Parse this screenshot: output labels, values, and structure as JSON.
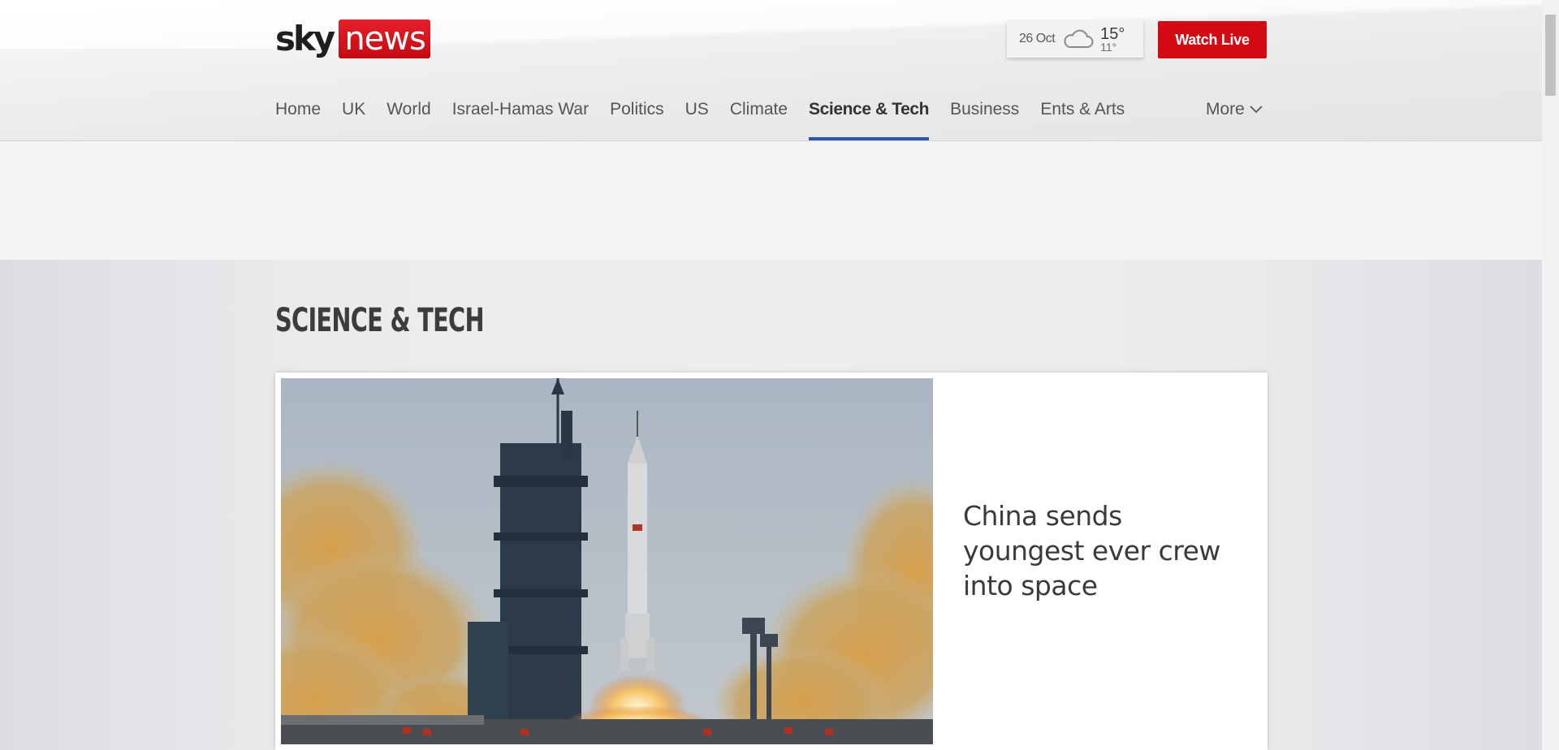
{
  "header": {
    "logo": {
      "sky": "sky",
      "news": "news"
    },
    "weather": {
      "date": "26 Oct",
      "icon": "cloud-icon",
      "high": "15°",
      "low": "11°"
    },
    "watch_live_label": "Watch Live",
    "nav": {
      "items": [
        {
          "label": "Home"
        },
        {
          "label": "UK"
        },
        {
          "label": "World"
        },
        {
          "label": "Israel-Hamas War"
        },
        {
          "label": "Politics"
        },
        {
          "label": "US"
        },
        {
          "label": "Climate"
        },
        {
          "label": "Science & Tech",
          "active": true
        },
        {
          "label": "Business"
        },
        {
          "label": "Ents & Arts"
        }
      ],
      "more_label": "More"
    }
  },
  "main": {
    "section_title": "SCIENCE & TECH",
    "lead_story": {
      "headline": "China sends youngest ever crew into space",
      "image": "rocket-launch-photo"
    }
  },
  "colors": {
    "brand_red": "#d10a14",
    "active_nav_underline": "#2d56a6",
    "text_dark": "#3a3a3a"
  }
}
